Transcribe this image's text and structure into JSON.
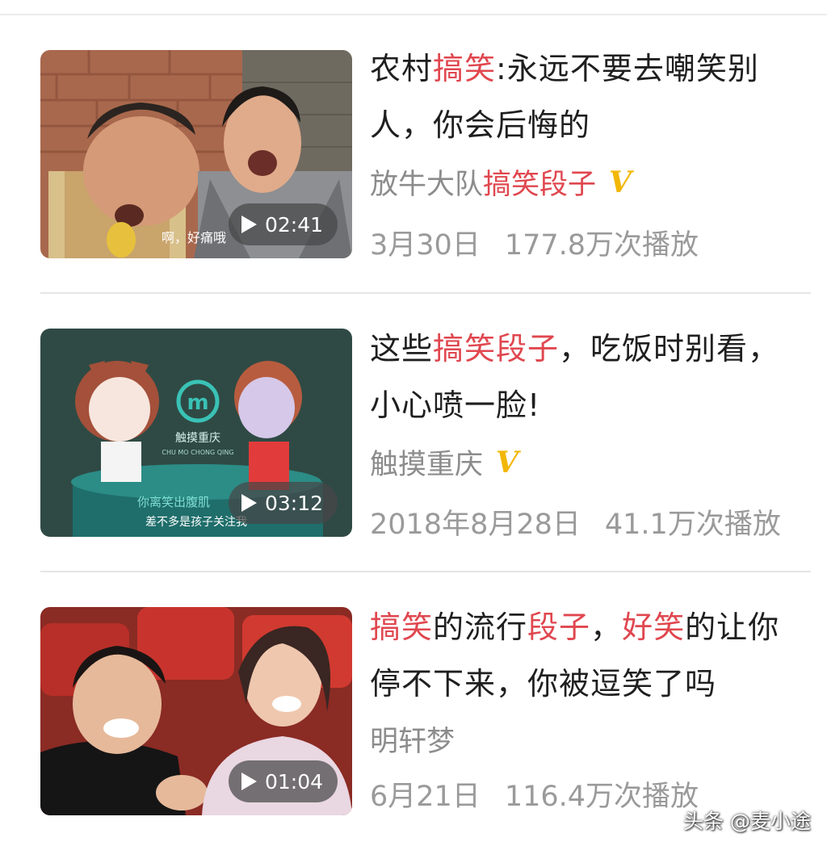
{
  "feed": [
    {
      "title_parts": [
        {
          "text": "农村",
          "hl": false
        },
        {
          "text": "搞笑",
          "hl": true
        },
        {
          "text": ":永远不要去嘲笑别人，你会后悔的",
          "hl": false
        }
      ],
      "author_parts": [
        {
          "text": "放牛大队",
          "hl": false
        },
        {
          "text": "搞笑段子",
          "hl": true
        }
      ],
      "verified_badge": "V",
      "date": "3月30日",
      "plays": "177.8万次播放",
      "duration": "02:41",
      "thumb_caption": "啊，好痛哦"
    },
    {
      "title_parts": [
        {
          "text": "这些",
          "hl": false
        },
        {
          "text": "搞笑段子",
          "hl": true
        },
        {
          "text": "，吃饭时别看，小心喷一脸!",
          "hl": false
        }
      ],
      "author_parts": [
        {
          "text": "触摸重庆",
          "hl": false
        }
      ],
      "verified_badge": "V",
      "date": "2018年8月28日",
      "plays": "41.1万次播放",
      "duration": "03:12",
      "thumb_logo_text": "触摸重庆",
      "thumb_logo_sub": "CHU MO CHONG QING",
      "thumb_caption_1": "你离笑出腹肌",
      "thumb_caption_2": "差不多是孩子关注我"
    },
    {
      "title_parts": [
        {
          "text": "搞笑",
          "hl": true
        },
        {
          "text": "的流行",
          "hl": false
        },
        {
          "text": "段子",
          "hl": true
        },
        {
          "text": "，",
          "hl": false
        },
        {
          "text": "好笑",
          "hl": true
        },
        {
          "text": "的让你停不下来，你被逗笑了吗",
          "hl": false
        }
      ],
      "author_parts": [
        {
          "text": "明轩梦",
          "hl": false
        }
      ],
      "verified_badge": "",
      "date": "6月21日",
      "plays": "116.4万次播放",
      "duration": "01:04"
    }
  ],
  "watermark": "头条 @麦小途",
  "colors": {
    "highlight": "#e0474f",
    "verified": "#f2b705",
    "meta_gray": "#9a9a9a",
    "title": "#1f1f1f"
  }
}
